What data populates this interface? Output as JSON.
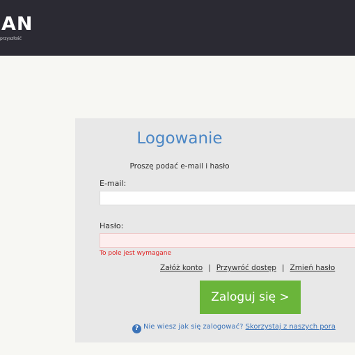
{
  "header": {
    "logo_text": "AN",
    "tagline": "przyszłość"
  },
  "login": {
    "title": "Logowanie",
    "subtitle": "Proszę podać e-mail i hasło",
    "email_label": "E-mail:",
    "email_value": "",
    "password_label": "Hasło:",
    "password_value": "",
    "password_error": "To pole jest wymagane",
    "links": {
      "create_account": "Załóż konto",
      "restore_access": "Przywróć dostęp",
      "change_password": "Zmień hasło",
      "separator": "|"
    },
    "submit_label": "Zaloguj się >",
    "help": {
      "icon": "?",
      "question": "Nie wiesz jak się zalogować?",
      "link": "Skorzystaj z naszych pora"
    }
  },
  "colors": {
    "header_bg": "#2b2a33",
    "title": "#4a86c5",
    "button": "#6ab53a",
    "error": "#e02020",
    "help": "#3b73b8"
  }
}
